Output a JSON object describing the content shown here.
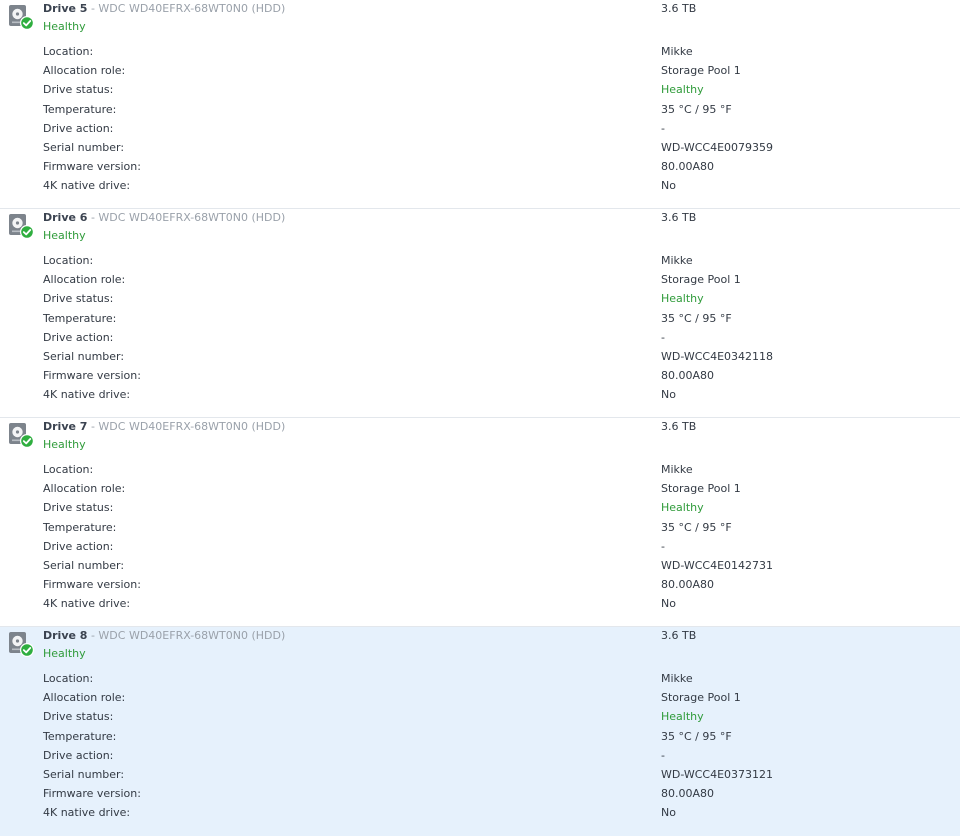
{
  "drives": [
    {
      "name": "Drive 5",
      "separator": " - ",
      "model": "WDC WD40EFRX-68WT0N0 (HDD)",
      "health": "Healthy",
      "capacity": "3.6 TB",
      "selected": false,
      "details": [
        {
          "label": "Location:",
          "value": "Mikke"
        },
        {
          "label": "Allocation role:",
          "value": "Storage Pool 1"
        },
        {
          "label": "Drive status:",
          "value": "Healthy"
        },
        {
          "label": "Temperature:",
          "value": "35 °C / 95 °F"
        },
        {
          "label": "Drive action:",
          "value": "-"
        },
        {
          "label": "Serial number:",
          "value": "WD-WCC4E0079359"
        },
        {
          "label": "Firmware version:",
          "value": "80.00A80"
        },
        {
          "label": "4K native drive:",
          "value": "No"
        }
      ]
    },
    {
      "name": "Drive 6",
      "separator": " - ",
      "model": "WDC WD40EFRX-68WT0N0 (HDD)",
      "health": "Healthy",
      "capacity": "3.6 TB",
      "selected": false,
      "details": [
        {
          "label": "Location:",
          "value": "Mikke"
        },
        {
          "label": "Allocation role:",
          "value": "Storage Pool 1"
        },
        {
          "label": "Drive status:",
          "value": "Healthy"
        },
        {
          "label": "Temperature:",
          "value": "35 °C / 95 °F"
        },
        {
          "label": "Drive action:",
          "value": "-"
        },
        {
          "label": "Serial number:",
          "value": "WD-WCC4E0342118"
        },
        {
          "label": "Firmware version:",
          "value": "80.00A80"
        },
        {
          "label": "4K native drive:",
          "value": "No"
        }
      ]
    },
    {
      "name": "Drive 7",
      "separator": " - ",
      "model": "WDC WD40EFRX-68WT0N0 (HDD)",
      "health": "Healthy",
      "capacity": "3.6 TB",
      "selected": false,
      "details": [
        {
          "label": "Location:",
          "value": "Mikke"
        },
        {
          "label": "Allocation role:",
          "value": "Storage Pool 1"
        },
        {
          "label": "Drive status:",
          "value": "Healthy"
        },
        {
          "label": "Temperature:",
          "value": "35 °C / 95 °F"
        },
        {
          "label": "Drive action:",
          "value": "-"
        },
        {
          "label": "Serial number:",
          "value": "WD-WCC4E0142731"
        },
        {
          "label": "Firmware version:",
          "value": "80.00A80"
        },
        {
          "label": "4K native drive:",
          "value": "No"
        }
      ]
    },
    {
      "name": "Drive 8",
      "separator": " - ",
      "model": "WDC WD40EFRX-68WT0N0 (HDD)",
      "health": "Healthy",
      "capacity": "3.6 TB",
      "selected": true,
      "details": [
        {
          "label": "Location:",
          "value": "Mikke"
        },
        {
          "label": "Allocation role:",
          "value": "Storage Pool 1"
        },
        {
          "label": "Drive status:",
          "value": "Healthy"
        },
        {
          "label": "Temperature:",
          "value": "35 °C / 95 °F"
        },
        {
          "label": "Drive action:",
          "value": "-"
        },
        {
          "label": "Serial number:",
          "value": "WD-WCC4E0373121"
        },
        {
          "label": "Firmware version:",
          "value": "80.00A80"
        },
        {
          "label": "4K native drive:",
          "value": "No"
        }
      ]
    }
  ],
  "icons": {
    "drive": "hdd-icon",
    "status": "check-circle-icon"
  },
  "colors": {
    "healthy": "#2f9b3a",
    "selected_bg": "#e6f1fc",
    "status_badge": "#2fae3f"
  }
}
